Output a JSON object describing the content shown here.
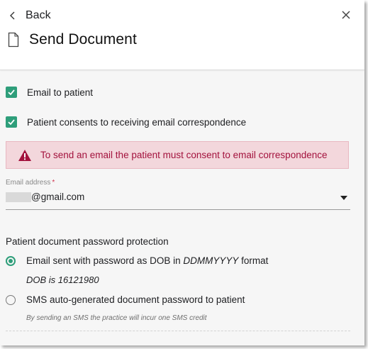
{
  "header": {
    "back_label": "Back",
    "title": "Send Document"
  },
  "options": {
    "email_to_patient": {
      "label": "Email to patient",
      "checked": true
    },
    "consent": {
      "label": "Patient consents to receiving email correspondence",
      "checked": true
    }
  },
  "alert": {
    "message": "To send an email the patient must consent to email correspondence",
    "color": "#a3123d",
    "background": "#f3d7dc"
  },
  "email": {
    "label": "Email address",
    "required_mark": "*",
    "value": "@gmail.com"
  },
  "password": {
    "section_label": "Patient document password protection",
    "option_dob": {
      "label_prefix": "Email sent with password as DOB in ",
      "format": "DDMMYYYY",
      "label_suffix": " format",
      "selected": true,
      "detail": "DOB is 16121980"
    },
    "option_sms": {
      "label": "SMS auto-generated document password to patient",
      "selected": false,
      "note": "By sending an SMS the practice will incur one SMS credit"
    }
  },
  "colors": {
    "accent": "#2e9e7a"
  },
  "icons": {
    "back": "chevron-left-icon",
    "close": "close-icon",
    "document": "document-icon",
    "warning": "warning-icon",
    "dropdown": "caret-down-icon"
  }
}
